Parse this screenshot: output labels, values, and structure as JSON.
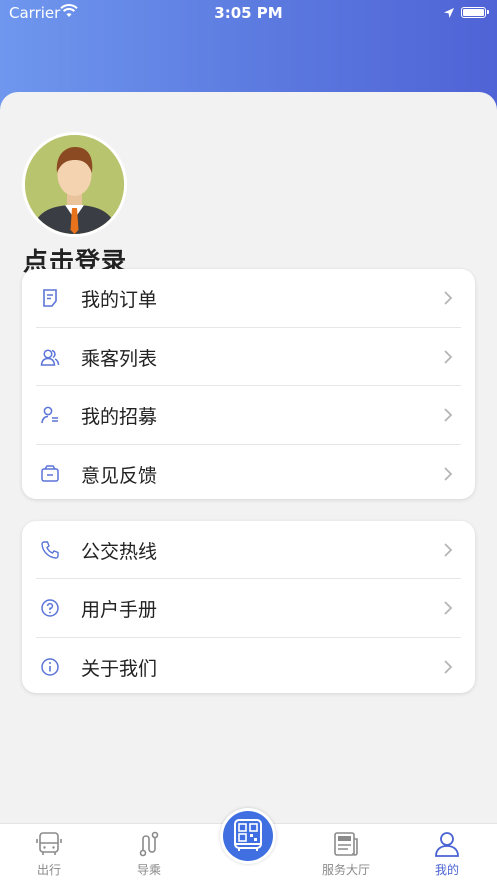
{
  "status_bar": {
    "carrier": "Carrier",
    "time": "3:05 PM"
  },
  "profile": {
    "login_prompt": "点击登录"
  },
  "menu_group_1": [
    {
      "label": "我的订单",
      "icon": "order-icon"
    },
    {
      "label": "乘客列表",
      "icon": "passengers-icon"
    },
    {
      "label": "我的招募",
      "icon": "recruit-icon"
    },
    {
      "label": "意见反馈",
      "icon": "feedback-icon"
    }
  ],
  "menu_group_2": [
    {
      "label": "公交热线",
      "icon": "phone-icon"
    },
    {
      "label": "用户手册",
      "icon": "help-icon"
    },
    {
      "label": "关于我们",
      "icon": "info-icon"
    }
  ],
  "tabbar": {
    "items": [
      {
        "label": "出行",
        "icon": "bus-icon"
      },
      {
        "label": "导乘",
        "icon": "route-icon"
      },
      {
        "label": "",
        "icon": "qr-bus-icon"
      },
      {
        "label": "服务大厅",
        "icon": "news-icon"
      },
      {
        "label": "我的",
        "icon": "person-icon"
      }
    ],
    "active": "我的"
  },
  "colors": {
    "accent": "#4a63d3",
    "header_start": "#6f97ee",
    "header_end": "#4f63d6",
    "icon_blue": "#5b74d8"
  }
}
